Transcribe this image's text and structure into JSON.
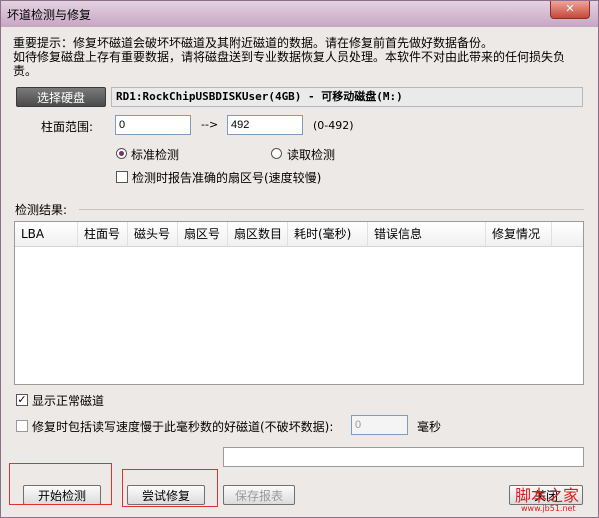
{
  "window": {
    "title": "坏道检测与修复",
    "close_label": "✕"
  },
  "notice": {
    "line1": "重要提示：修复坏磁道会破坏坏磁道及其附近磁道的数据。请在修复前首先做好数据备份。",
    "line2": "如待修复磁盘上存有重要数据，请将磁盘送到专业数据恢复人员处理。本软件不对由此带来的任何损失负责。"
  },
  "disk": {
    "select_label": "选择硬盘",
    "selected": "RD1:RockChipUSBDISKUser(4GB) - 可移动磁盘(M:)"
  },
  "cylinder": {
    "label": "柱面范围:",
    "from": "0",
    "arrow": "-->",
    "to": "492",
    "range_hint": "(0-492)"
  },
  "options": {
    "standard_check": "标准检测",
    "read_check": "读取检测",
    "report_sector": "检测时报告准确的扇区号(速度较慢)"
  },
  "results": {
    "label": "检测结果:",
    "columns": [
      "LBA",
      "柱面号",
      "磁头号",
      "扇区号",
      "扇区数目",
      "耗时(毫秒)",
      "错误信息",
      "修复情况"
    ]
  },
  "show_normal": {
    "label": "显示正常磁道",
    "checked": true
  },
  "repair_slow": {
    "label": "修复时包括读写速度慢于此毫秒数的好磁道(不破坏数据):",
    "value": "0",
    "unit": "毫秒"
  },
  "buttons": {
    "start": "开始检测",
    "try_repair": "尝试修复",
    "save_report": "保存报表",
    "close": "关闭"
  },
  "watermark": {
    "text": "脚本之家",
    "url": "www.jb51.net"
  },
  "colors": {
    "title_bar": "#c6a6c3",
    "radio_dot": "#7b2f6e",
    "highlight": "#e03030"
  }
}
